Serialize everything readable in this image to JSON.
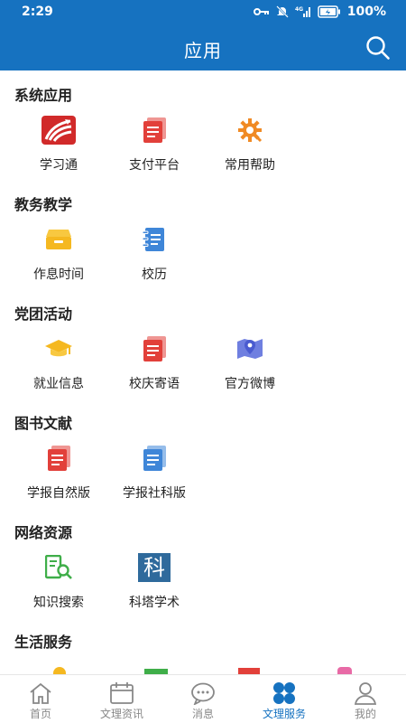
{
  "status": {
    "time": "2:29",
    "battery": "100%"
  },
  "header": {
    "title": "应用"
  },
  "colors": {
    "primary": "#1672c0",
    "red": "#e2403a",
    "orange": "#f08a24",
    "yellow": "#f5b820",
    "blue": "#3f86d8",
    "green": "#3fae49"
  },
  "sections": [
    {
      "title": "系统应用",
      "items": [
        {
          "label": "学习通",
          "icon": "xuexitong-logo-icon"
        },
        {
          "label": "支付平台",
          "icon": "document-icon"
        },
        {
          "label": "常用帮助",
          "icon": "gear-help-icon"
        }
      ]
    },
    {
      "title": "教务教学",
      "items": [
        {
          "label": "作息时间",
          "icon": "box-icon"
        },
        {
          "label": "校历",
          "icon": "notebook-icon"
        }
      ]
    },
    {
      "title": "党团活动",
      "items": [
        {
          "label": "就业信息",
          "icon": "graduation-cap-icon"
        },
        {
          "label": "校庆寄语",
          "icon": "document-icon"
        },
        {
          "label": "官方微博",
          "icon": "map-pin-icon"
        }
      ]
    },
    {
      "title": "图书文献",
      "items": [
        {
          "label": "学报自然版",
          "icon": "document-icon"
        },
        {
          "label": "学报社科版",
          "icon": "document-icon"
        }
      ]
    },
    {
      "title": "网络资源",
      "items": [
        {
          "label": "知识搜索",
          "icon": "book-search-icon"
        },
        {
          "label": "科塔学术",
          "icon": "ke-logo-icon",
          "glyph": "科"
        }
      ]
    },
    {
      "title": "生活服务",
      "items": []
    }
  ],
  "bottom_nav": [
    {
      "label": "首页",
      "icon": "home-icon",
      "active": false
    },
    {
      "label": "文理资讯",
      "icon": "calendar-icon",
      "active": false
    },
    {
      "label": "消息",
      "icon": "chat-icon",
      "active": false
    },
    {
      "label": "文理服务",
      "icon": "apps-icon",
      "active": true
    },
    {
      "label": "我的",
      "icon": "user-icon",
      "active": false
    }
  ]
}
